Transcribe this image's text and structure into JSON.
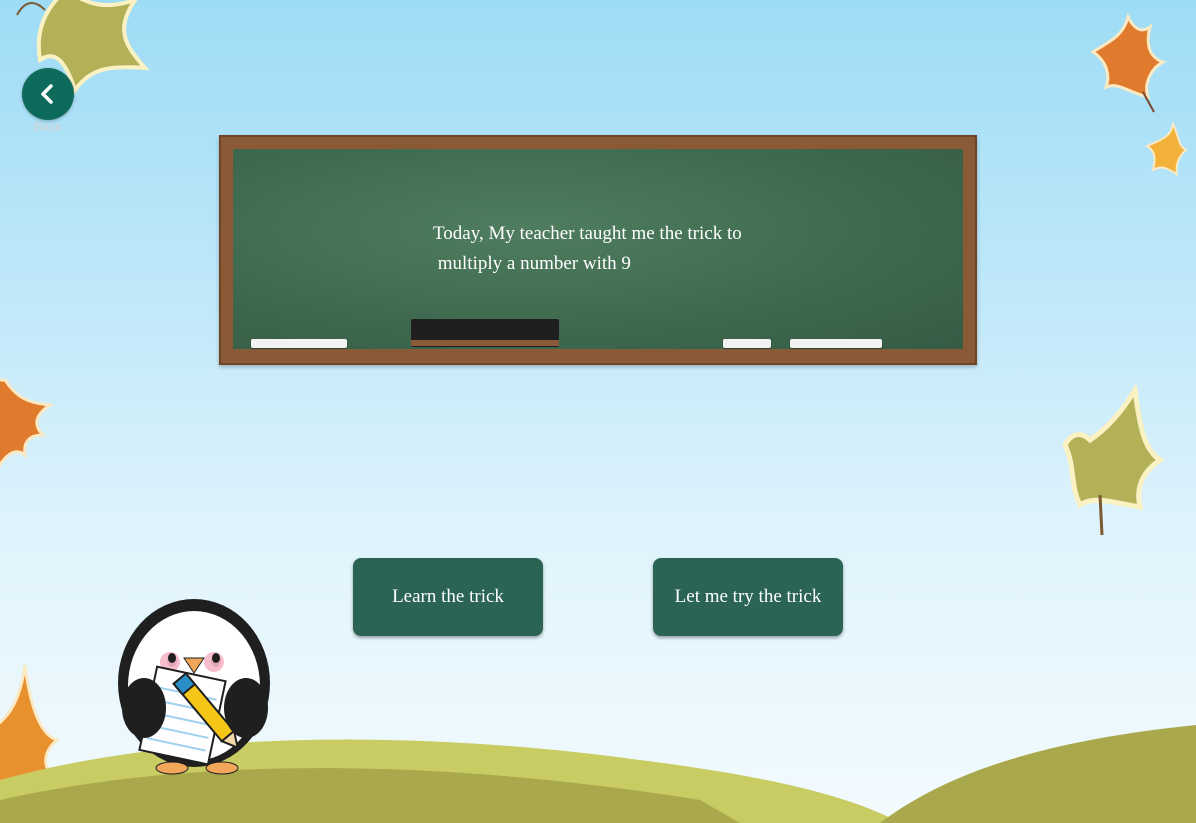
{
  "nav": {
    "back_label": "Back"
  },
  "chalkboard": {
    "line1": "Today, My teacher taught me the trick to",
    "line2": " multiply a number with 9"
  },
  "actions": {
    "learn_label": "Learn the trick",
    "try_label": "Let me try the trick"
  },
  "colors": {
    "button": "#2b6455",
    "back_button": "#0e6b5b",
    "board": "#3f6a4f",
    "frame": "#8a5a36"
  },
  "icons": [
    "chevron-left-icon",
    "leaf-icon",
    "penguin-mascot"
  ]
}
